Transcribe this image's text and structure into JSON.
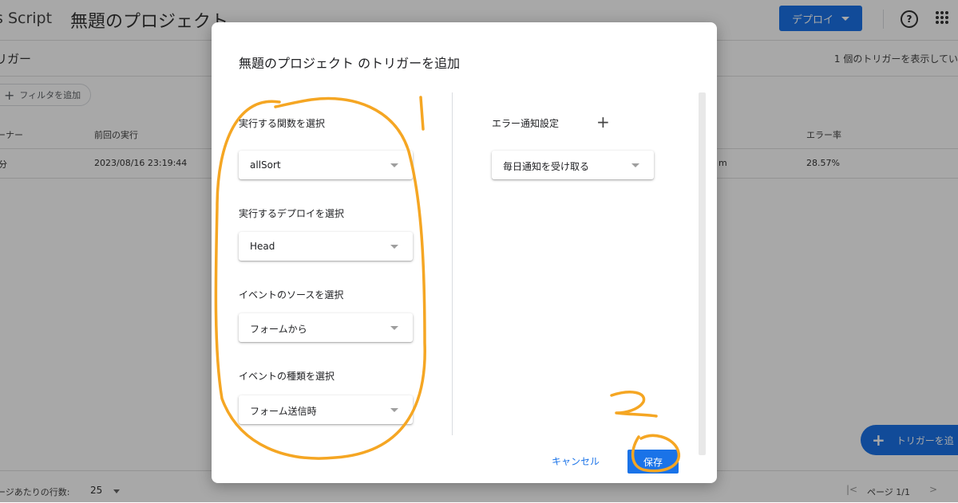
{
  "app": {
    "name": "s Script",
    "project_title": "無題のプロジェクト",
    "deploy_label": "デプロイ",
    "help_icon": "?",
    "apps_icon": "apps-grid-icon"
  },
  "section": {
    "title": "リガー",
    "count_text": "1 個のトリガーを表示してい",
    "filter_label": "フィルタを追加"
  },
  "table": {
    "headers": [
      "ーナー",
      "前回の実行",
      "エラー率"
    ],
    "row": {
      "owner": "分",
      "last_run": "2023/08/16 23:19:44",
      "mid": "m",
      "error_rate": "28.57%"
    }
  },
  "footer": {
    "rows_label": "ージあたりの行数:",
    "rows_value": "25",
    "first_icon": "|<",
    "prev_icon": "<",
    "page_info": "ページ 1/1",
    "next_icon": ">"
  },
  "fab": {
    "label": "トリガーを追"
  },
  "dialog": {
    "title": "無題のプロジェクト のトリガーを追加",
    "fields": [
      {
        "label": "実行する関数を選択",
        "value": "allSort"
      },
      {
        "label": "実行するデプロイを選択",
        "value": "Head"
      },
      {
        "label": "イベントのソースを選択",
        "value": "フォームから"
      },
      {
        "label": "イベントの種類を選択",
        "value": "フォーム送信時"
      }
    ],
    "error_label": "エラー通知設定",
    "error_value": "毎日通知を受け取る",
    "cancel_label": "キャンセル",
    "save_label": "保存"
  },
  "annotations": {
    "color": "#f5a623",
    "mark_1": "1",
    "mark_2": "2"
  }
}
